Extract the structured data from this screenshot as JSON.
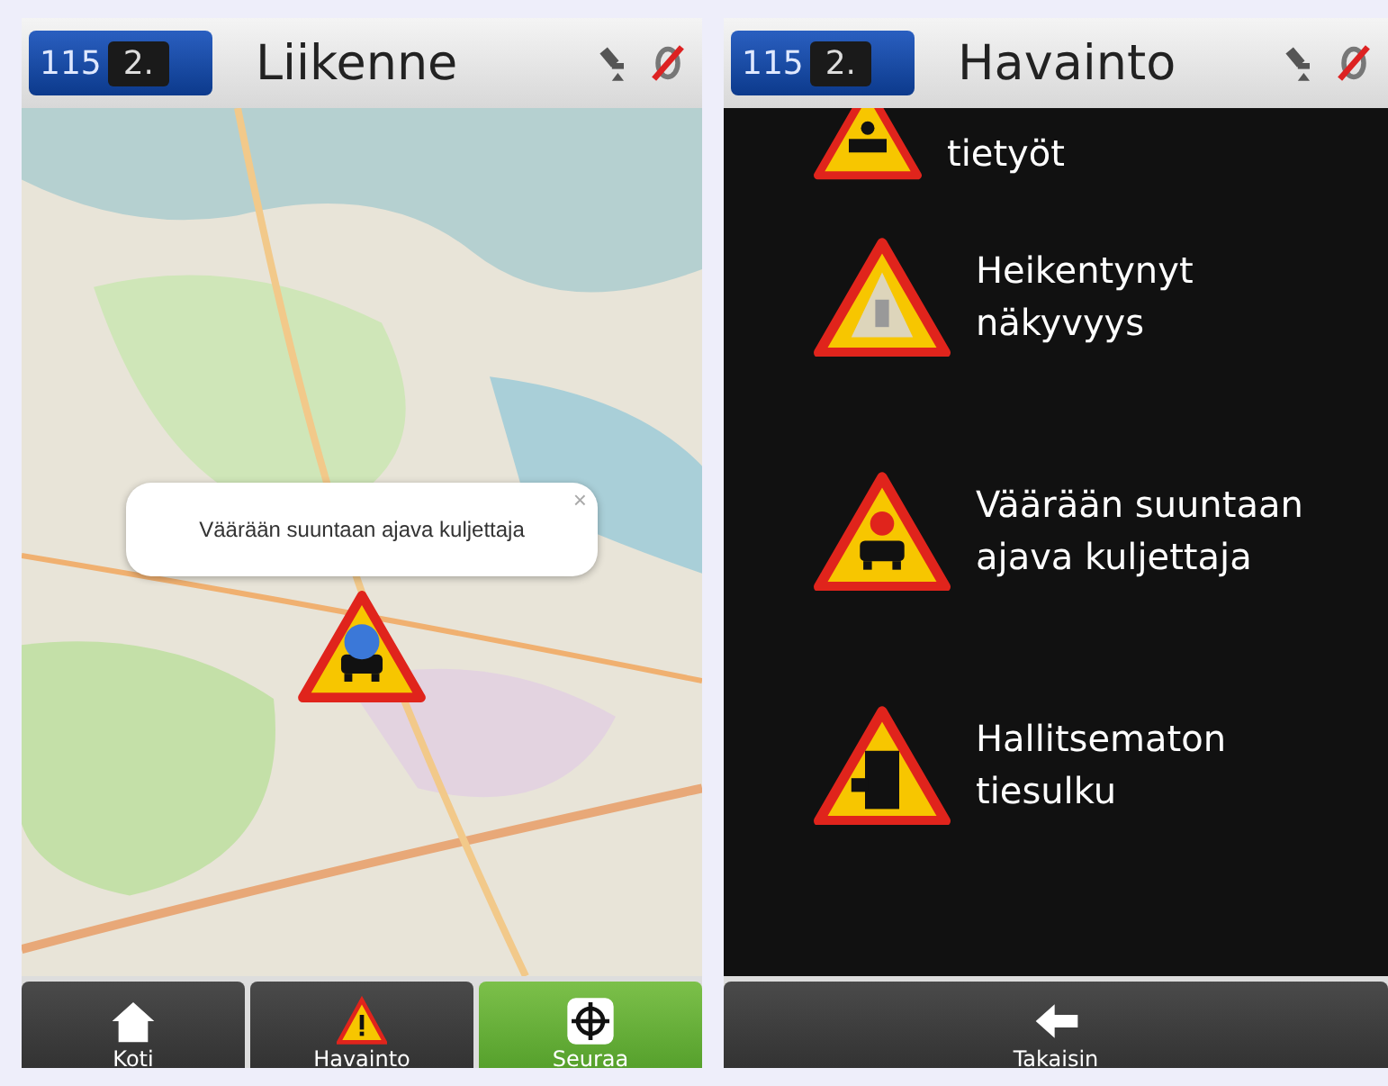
{
  "screens": [
    {
      "header": {
        "badge_number": "115",
        "badge_rank": "2.",
        "title": "Liikenne"
      },
      "popup": {
        "text": "Väärään suuntaan ajava kuljettaja",
        "close": "×"
      },
      "nav": [
        {
          "label": "Koti",
          "kind": "home",
          "selected": false
        },
        {
          "label": "Havainto",
          "kind": "warning",
          "selected": false
        },
        {
          "label": "Seuraa",
          "kind": "target",
          "selected": true
        }
      ]
    },
    {
      "header": {
        "badge_number": "115",
        "badge_rank": "2.",
        "title": "Havainto"
      },
      "items": [
        {
          "label": "tietyöt",
          "kind": "roadwork"
        },
        {
          "label": "Heikentynyt näkyvyys",
          "kind": "visibility"
        },
        {
          "label": "Väärään suuntaan ajava kuljettaja",
          "kind": "wrongway"
        },
        {
          "label": "Hallitsematon tiesulku",
          "kind": "roadblock"
        }
      ],
      "nav": [
        {
          "label": "Takaisin",
          "kind": "back",
          "selected": false
        }
      ]
    }
  ]
}
